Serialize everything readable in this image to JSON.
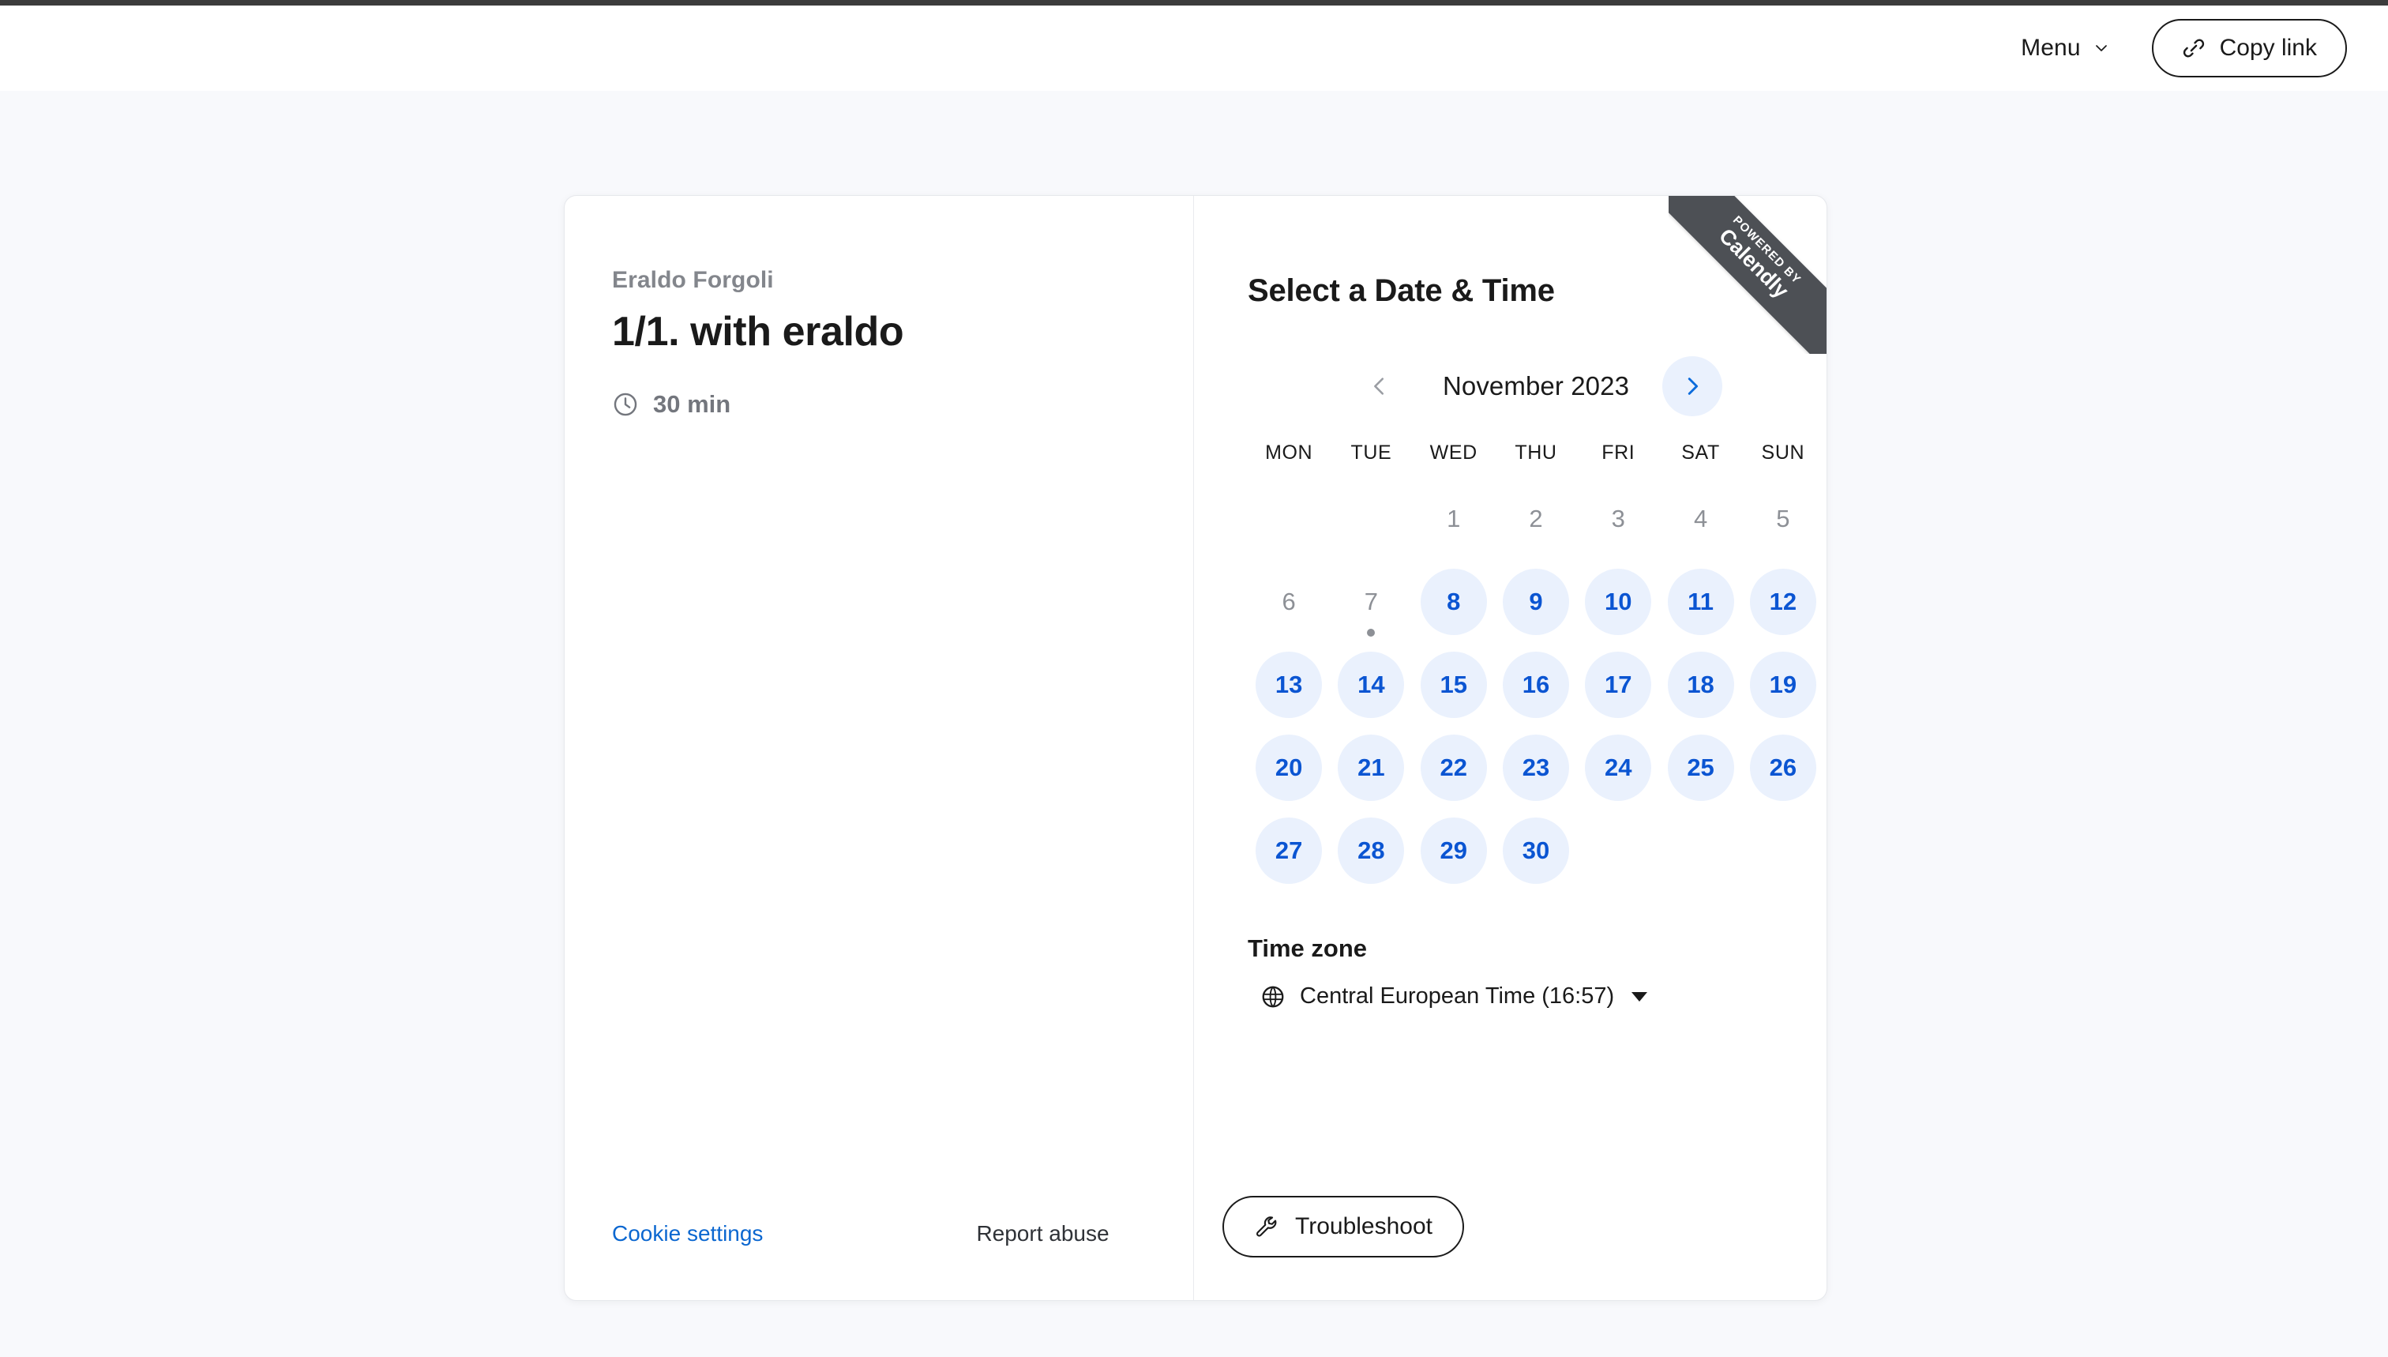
{
  "header": {
    "menu_label": "Menu",
    "menu_icon": "chevron-down-icon",
    "copy_link_label": "Copy link",
    "copy_link_icon": "link-icon"
  },
  "event": {
    "host_name": "Eraldo Forgoli",
    "title": "1/1. with eraldo",
    "duration": "30 min",
    "duration_icon": "clock-icon"
  },
  "left_footer": {
    "cookie_settings": "Cookie settings",
    "report_abuse": "Report abuse"
  },
  "booking": {
    "panel_title": "Select a Date & Time",
    "month_label": "November 2023",
    "prev_icon": "chevron-left-icon",
    "next_icon": "chevron-right-icon",
    "day_headers": [
      "MON",
      "TUE",
      "WED",
      "THU",
      "FRI",
      "SAT",
      "SUN"
    ],
    "days": [
      {
        "label": "",
        "state": "empty"
      },
      {
        "label": "",
        "state": "empty"
      },
      {
        "label": "1",
        "state": "disabled"
      },
      {
        "label": "2",
        "state": "disabled"
      },
      {
        "label": "3",
        "state": "disabled"
      },
      {
        "label": "4",
        "state": "disabled"
      },
      {
        "label": "5",
        "state": "disabled"
      },
      {
        "label": "6",
        "state": "disabled"
      },
      {
        "label": "7",
        "state": "disabled",
        "today": true
      },
      {
        "label": "8",
        "state": "available"
      },
      {
        "label": "9",
        "state": "available"
      },
      {
        "label": "10",
        "state": "available"
      },
      {
        "label": "11",
        "state": "available"
      },
      {
        "label": "12",
        "state": "available"
      },
      {
        "label": "13",
        "state": "available"
      },
      {
        "label": "14",
        "state": "available"
      },
      {
        "label": "15",
        "state": "available"
      },
      {
        "label": "16",
        "state": "available"
      },
      {
        "label": "17",
        "state": "available"
      },
      {
        "label": "18",
        "state": "available"
      },
      {
        "label": "19",
        "state": "available"
      },
      {
        "label": "20",
        "state": "available"
      },
      {
        "label": "21",
        "state": "available"
      },
      {
        "label": "22",
        "state": "available"
      },
      {
        "label": "23",
        "state": "available"
      },
      {
        "label": "24",
        "state": "available"
      },
      {
        "label": "25",
        "state": "available"
      },
      {
        "label": "26",
        "state": "available"
      },
      {
        "label": "27",
        "state": "available"
      },
      {
        "label": "28",
        "state": "available"
      },
      {
        "label": "29",
        "state": "available"
      },
      {
        "label": "30",
        "state": "available"
      },
      {
        "label": "",
        "state": "empty"
      },
      {
        "label": "",
        "state": "empty"
      },
      {
        "label": "",
        "state": "empty"
      }
    ],
    "timezone_label": "Time zone",
    "timezone_value": "Central European Time (16:57)",
    "timezone_icon": "globe-icon",
    "troubleshoot_label": "Troubleshoot",
    "troubleshoot_icon": "wrench-icon"
  },
  "ribbon": {
    "powered_by": "POWERED BY",
    "brand": "Calendly"
  },
  "colors": {
    "page_background": "#f8f9fc",
    "card_background": "#ffffff",
    "accent_blue": "#0b55d2",
    "available_day_background": "#eaf1fd",
    "link_blue": "#0b67d0",
    "muted_text": "#83868c",
    "ribbon_background": "#4d5055"
  }
}
